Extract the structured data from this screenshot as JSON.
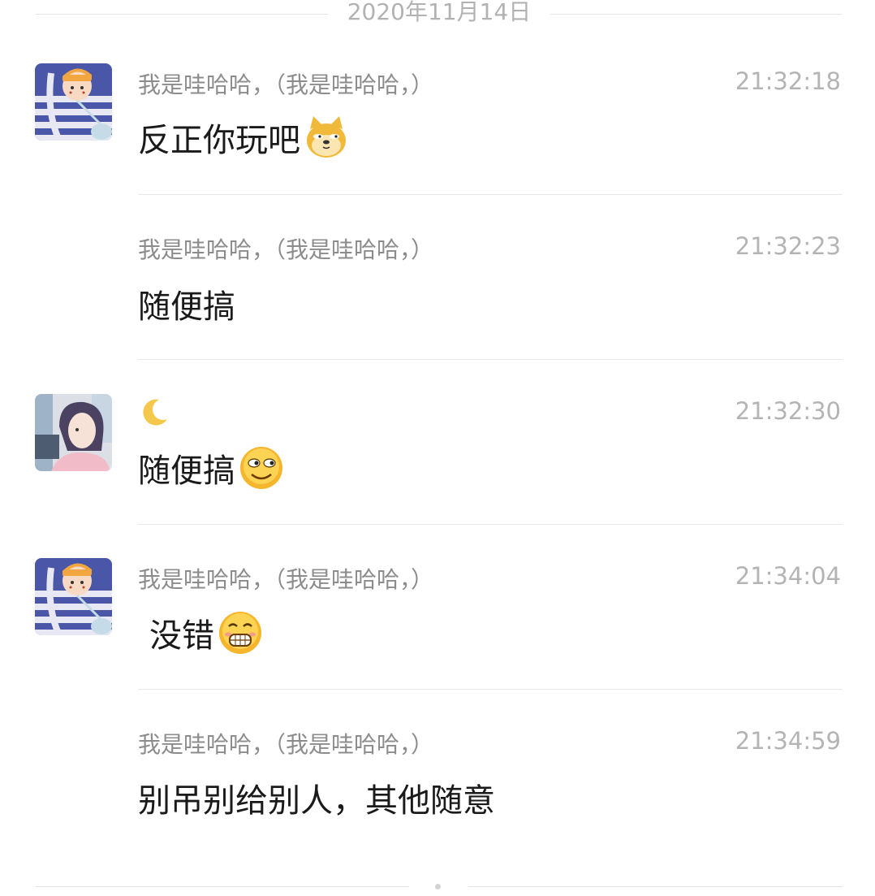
{
  "date_divider": "2020年11月14日",
  "messages": [
    {
      "sender": "我是哇哈哈，（我是哇哈哈，）",
      "time": "21:32:18",
      "text": "反正你玩吧",
      "emoji": "doge-emoji",
      "avatar": "avatar-striped-shirt-boy"
    },
    {
      "sender": "我是哇哈哈，（我是哇哈哈，）",
      "time": "21:32:23",
      "text": "随便搞"
    },
    {
      "sender_icon": "crescent-moon-icon",
      "time": "21:32:30",
      "text": "随便搞",
      "emoji": "smirk-emoji",
      "avatar": "avatar-anime-girl"
    },
    {
      "sender": "我是哇哈哈，（我是哇哈哈，）",
      "time": "21:34:04",
      "text": "没错",
      "emoji": "grin-emoji",
      "avatar": "avatar-striped-shirt-boy"
    },
    {
      "sender": "我是哇哈哈，（我是哇哈哈，）",
      "time": "21:34:59",
      "text": "别吊别给别人，其他随意"
    }
  ],
  "colors": {
    "sender": "#8c8c8c",
    "time": "#b4b4b4",
    "content": "#1a1a1a",
    "divider": "#e8e8e8"
  }
}
